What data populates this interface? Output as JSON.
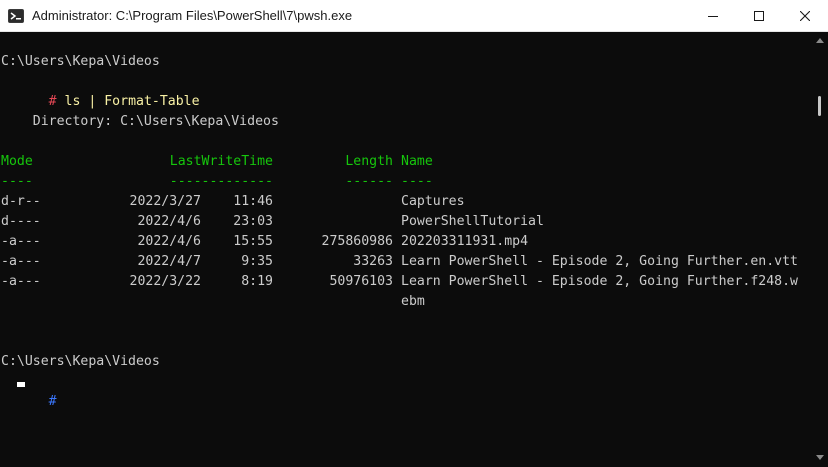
{
  "window": {
    "title": "Administrator: C:\\Program Files\\PowerShell\\7\\pwsh.exe",
    "icon": "powershell-icon",
    "controls": [
      "minimize-icon",
      "maximize-icon",
      "close-icon"
    ]
  },
  "terminal": {
    "prompt_path_1": "C:\\Users\\Kepa\\Videos",
    "prompt_symbol": "#",
    "command": "ls | Format-Table",
    "directory_line": "    Directory: C:\\Users\\Kepa\\Videos",
    "headers": {
      "mode": "Mode",
      "lastwritetime": "LastWriteTime",
      "length": "Length",
      "name": "Name"
    },
    "underlines": {
      "mode": "----",
      "lastwritetime": "-------------",
      "length": "------",
      "name": "----"
    },
    "rows": [
      {
        "mode": "d-r--",
        "date": "2022/3/27",
        "time": "11:46",
        "length": "",
        "name": "Captures"
      },
      {
        "mode": "d----",
        "date": "2022/4/6",
        "time": "23:03",
        "length": "",
        "name": "PowerShellTutorial"
      },
      {
        "mode": "-a---",
        "date": "2022/4/6",
        "time": "15:55",
        "length": "275860986",
        "name": "202203311931.mp4"
      },
      {
        "mode": "-a---",
        "date": "2022/4/7",
        "time": "9:35",
        "length": "33263",
        "name": "Learn PowerShell - Episode 2, Going Further.en.vtt"
      },
      {
        "mode": "-a---",
        "date": "2022/3/22",
        "time": "8:19",
        "length": "50976103",
        "name": "Learn PowerShell - Episode 2, Going Further.f248.w",
        "name_wrap": "ebm"
      }
    ],
    "prompt_path_2": "C:\\Users\\Kepa\\Videos",
    "prompt_symbol_2": "#"
  },
  "colors": {
    "background": "#0c0c0c",
    "text": "#cccccc",
    "prompt_hash": "#e74856",
    "command": "#f9f1a5",
    "header": "#16c60c",
    "prompt_hash_active": "#3b78ff"
  }
}
